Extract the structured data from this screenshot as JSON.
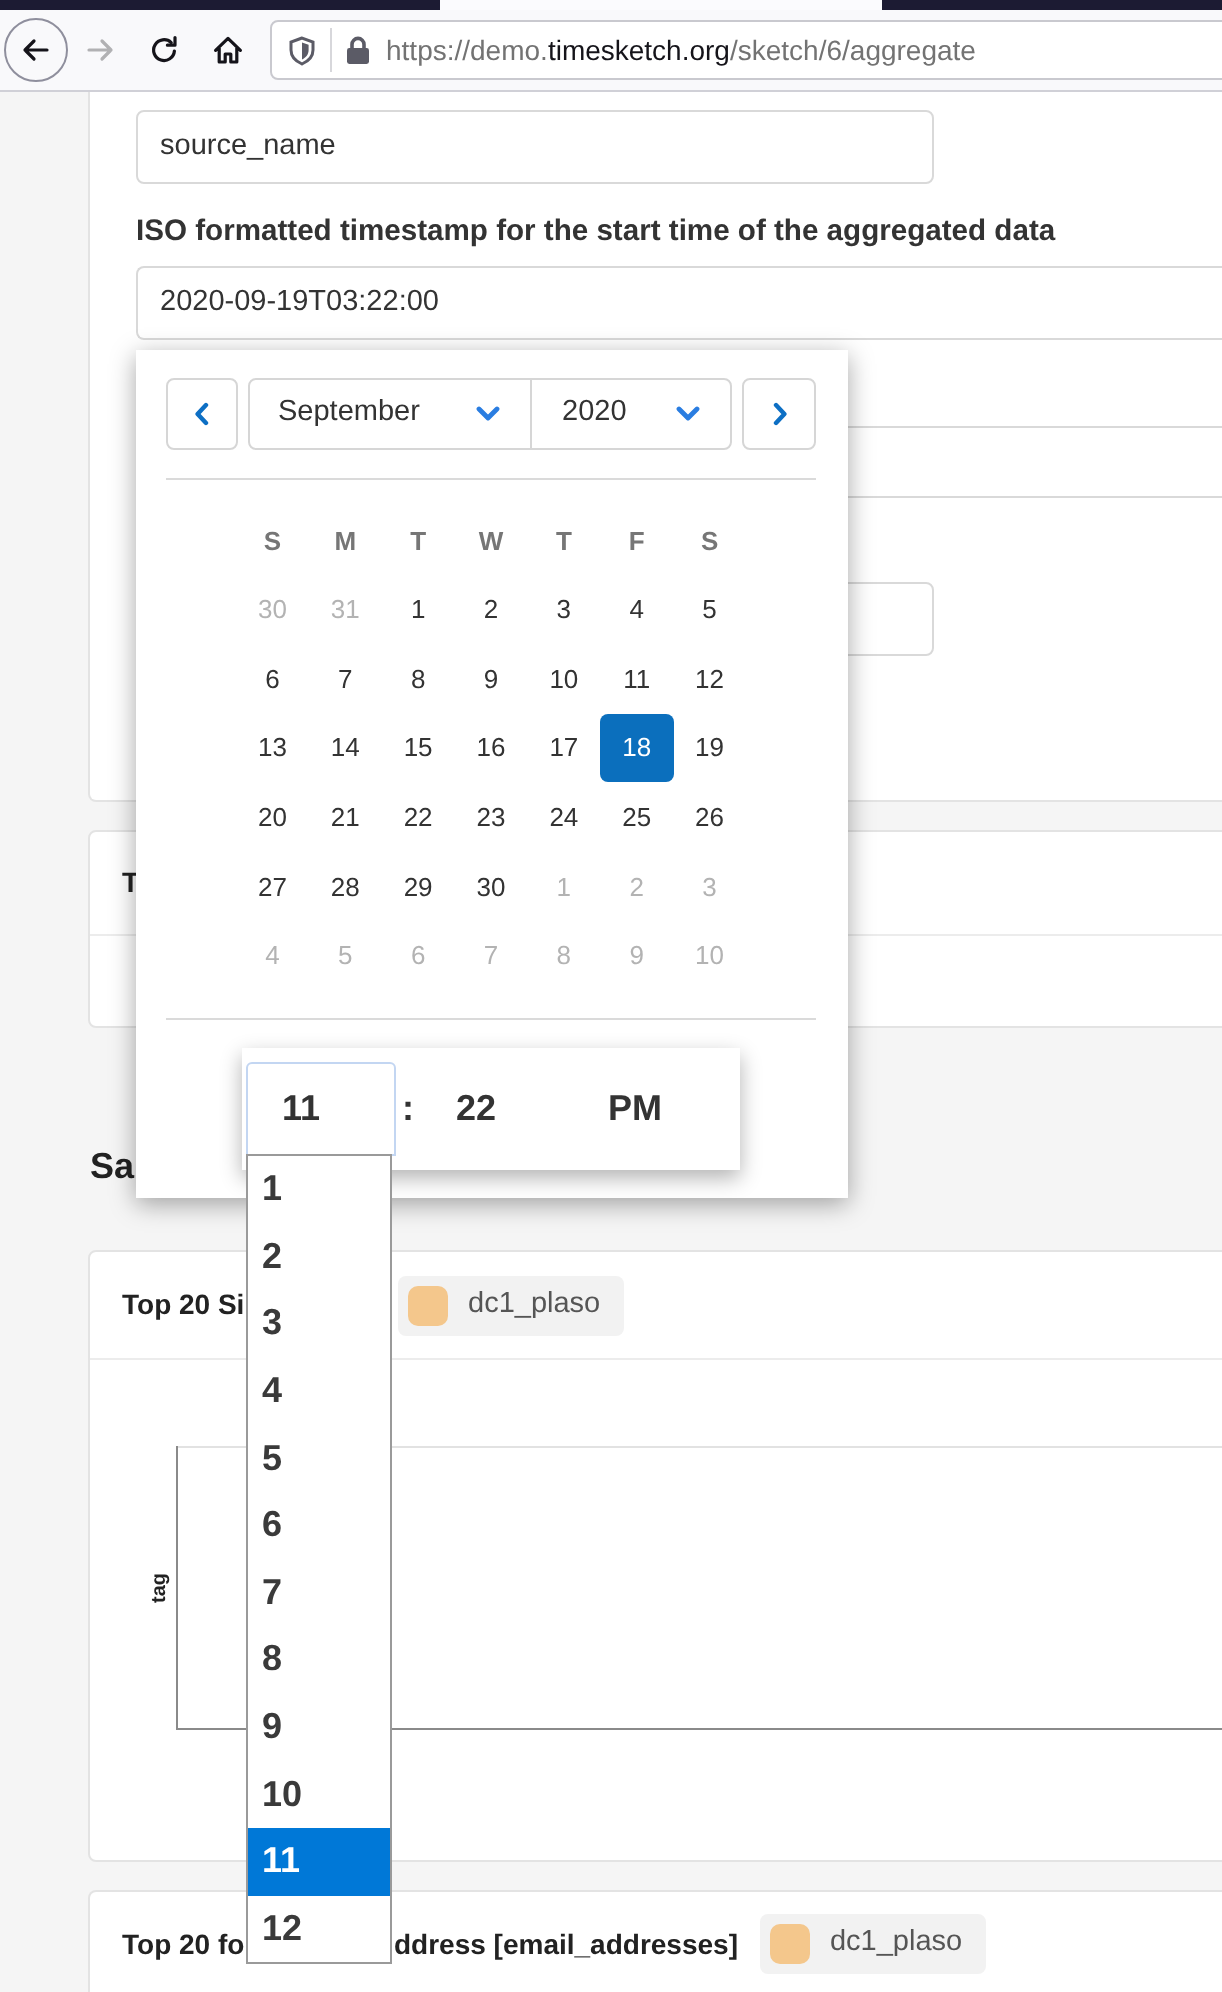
{
  "browser": {
    "tab_strip": [
      {
        "selected": false
      },
      {
        "selected": true
      },
      {
        "selected": false
      }
    ],
    "nav_buttons": [
      {
        "kind": "back",
        "disabled": false
      },
      {
        "kind": "forward",
        "disabled": true
      },
      {
        "kind": "reload",
        "disabled": false
      },
      {
        "kind": "home",
        "disabled": false
      }
    ],
    "url_parts": [
      {
        "text": "https://demo.",
        "kind": "dim"
      },
      {
        "text": "timesketch.org",
        "kind": "host"
      },
      {
        "text": "/sketch/6/aggregate",
        "kind": "dim"
      }
    ]
  },
  "form": {
    "source_field": {
      "value": "source_name"
    },
    "start_label": "ISO formatted timestamp for the start time of the aggregated data",
    "start_field": {
      "value": "2020-09-19T03:22:00"
    }
  },
  "result_panel": {
    "title": "T"
  },
  "section_heading": "Sa",
  "aggregations": [
    {
      "title_start": "Top 20 Si",
      "chip": {
        "label": "dc1_plaso",
        "color": "#f4c78c"
      },
      "chart": {
        "axis_label": "tag"
      }
    },
    {
      "title_start": "Top 20 fo",
      "title_end": "ddress [email_addresses]",
      "chip": {
        "label": "dc1_plaso",
        "color": "#f4c78c"
      }
    }
  ],
  "date_picker": {
    "month": "September",
    "year": "2020",
    "weekdays": [
      "S",
      "M",
      "T",
      "W",
      "T",
      "F",
      "S"
    ],
    "weeks": [
      [
        {
          "day": "30",
          "outside_month": true,
          "selected": false
        },
        {
          "day": "31",
          "outside_month": true,
          "selected": false
        },
        {
          "day": "1",
          "outside_month": false,
          "selected": false
        },
        {
          "day": "2",
          "outside_month": false,
          "selected": false
        },
        {
          "day": "3",
          "outside_month": false,
          "selected": false
        },
        {
          "day": "4",
          "outside_month": false,
          "selected": false
        },
        {
          "day": "5",
          "outside_month": false,
          "selected": false
        }
      ],
      [
        {
          "day": "6",
          "outside_month": false,
          "selected": false
        },
        {
          "day": "7",
          "outside_month": false,
          "selected": false
        },
        {
          "day": "8",
          "outside_month": false,
          "selected": false
        },
        {
          "day": "9",
          "outside_month": false,
          "selected": false
        },
        {
          "day": "10",
          "outside_month": false,
          "selected": false
        },
        {
          "day": "11",
          "outside_month": false,
          "selected": false
        },
        {
          "day": "12",
          "outside_month": false,
          "selected": false
        }
      ],
      [
        {
          "day": "13",
          "outside_month": false,
          "selected": false
        },
        {
          "day": "14",
          "outside_month": false,
          "selected": false
        },
        {
          "day": "15",
          "outside_month": false,
          "selected": false
        },
        {
          "day": "16",
          "outside_month": false,
          "selected": false
        },
        {
          "day": "17",
          "outside_month": false,
          "selected": false
        },
        {
          "day": "18",
          "outside_month": false,
          "selected": true
        },
        {
          "day": "19",
          "outside_month": false,
          "selected": false
        }
      ],
      [
        {
          "day": "20",
          "outside_month": false,
          "selected": false
        },
        {
          "day": "21",
          "outside_month": false,
          "selected": false
        },
        {
          "day": "22",
          "outside_month": false,
          "selected": false
        },
        {
          "day": "23",
          "outside_month": false,
          "selected": false
        },
        {
          "day": "24",
          "outside_month": false,
          "selected": false
        },
        {
          "day": "25",
          "outside_month": false,
          "selected": false
        },
        {
          "day": "26",
          "outside_month": false,
          "selected": false
        }
      ],
      [
        {
          "day": "27",
          "outside_month": false,
          "selected": false
        },
        {
          "day": "28",
          "outside_month": false,
          "selected": false
        },
        {
          "day": "29",
          "outside_month": false,
          "selected": false
        },
        {
          "day": "30",
          "outside_month": false,
          "selected": false
        },
        {
          "day": "1",
          "outside_month": true,
          "selected": false
        },
        {
          "day": "2",
          "outside_month": true,
          "selected": false
        },
        {
          "day": "3",
          "outside_month": true,
          "selected": false
        }
      ],
      [
        {
          "day": "4",
          "outside_month": true,
          "selected": false
        },
        {
          "day": "5",
          "outside_month": true,
          "selected": false
        },
        {
          "day": "6",
          "outside_month": true,
          "selected": false
        },
        {
          "day": "7",
          "outside_month": true,
          "selected": false
        },
        {
          "day": "8",
          "outside_month": true,
          "selected": false
        },
        {
          "day": "9",
          "outside_month": true,
          "selected": false
        },
        {
          "day": "10",
          "outside_month": true,
          "selected": false
        }
      ]
    ],
    "time": {
      "hour": "11",
      "separator": ":",
      "minute": "22",
      "period": "PM"
    },
    "hour_options": [
      {
        "label": "1",
        "selected": false
      },
      {
        "label": "2",
        "selected": false
      },
      {
        "label": "3",
        "selected": false
      },
      {
        "label": "4",
        "selected": false
      },
      {
        "label": "5",
        "selected": false
      },
      {
        "label": "6",
        "selected": false
      },
      {
        "label": "7",
        "selected": false
      },
      {
        "label": "8",
        "selected": false
      },
      {
        "label": "9",
        "selected": false
      },
      {
        "label": "10",
        "selected": false
      },
      {
        "label": "11",
        "selected": true
      },
      {
        "label": "12",
        "selected": false
      }
    ]
  }
}
